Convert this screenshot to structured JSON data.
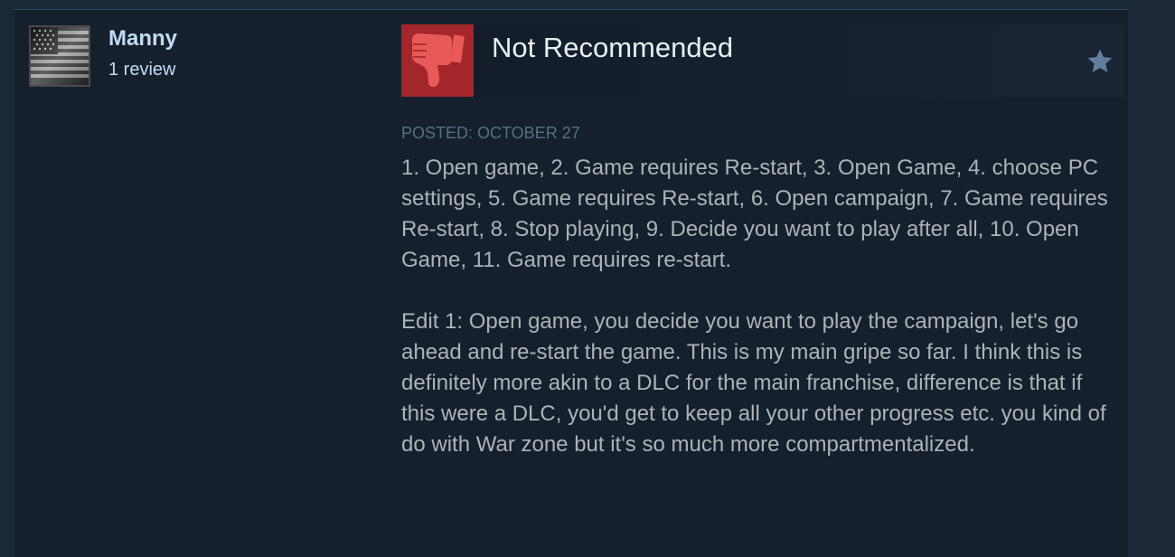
{
  "author": {
    "name": "Manny",
    "review_count": "1 review",
    "avatar_icon": "american-flag-avatar"
  },
  "review": {
    "verdict": "Not Recommended",
    "verdict_icon": "thumbs-down-icon",
    "verdict_color": "#a3262a",
    "award_icon": "star-icon",
    "posted": "POSTED: OCTOBER 27",
    "paragraphs": [
      "1. Open game, 2. Game requires Re-start, 3. Open Game, 4. choose PC settings, 5. Game requires Re-start, 6. Open campaign, 7. Game requires Re-start, 8. Stop playing, 9. Decide you want to play after all, 10. Open Game, 11. Game requires re-start.",
      "Edit 1: Open game, you decide you want to play the campaign, let's go ahead and re-start the game. This is my main gripe so far. I think this is definitely more akin to a DLC for the main franchise, difference is that if this were a DLC, you'd get to keep all your other progress etc. you kind of do with War zone but it's so much more compartmentalized."
    ]
  },
  "colors": {
    "page_bg": "#1b2838",
    "card_bg": "#16202d",
    "author_link": "#c1dbf4",
    "body_text": "#acb2b8",
    "date_text": "#56707f"
  }
}
